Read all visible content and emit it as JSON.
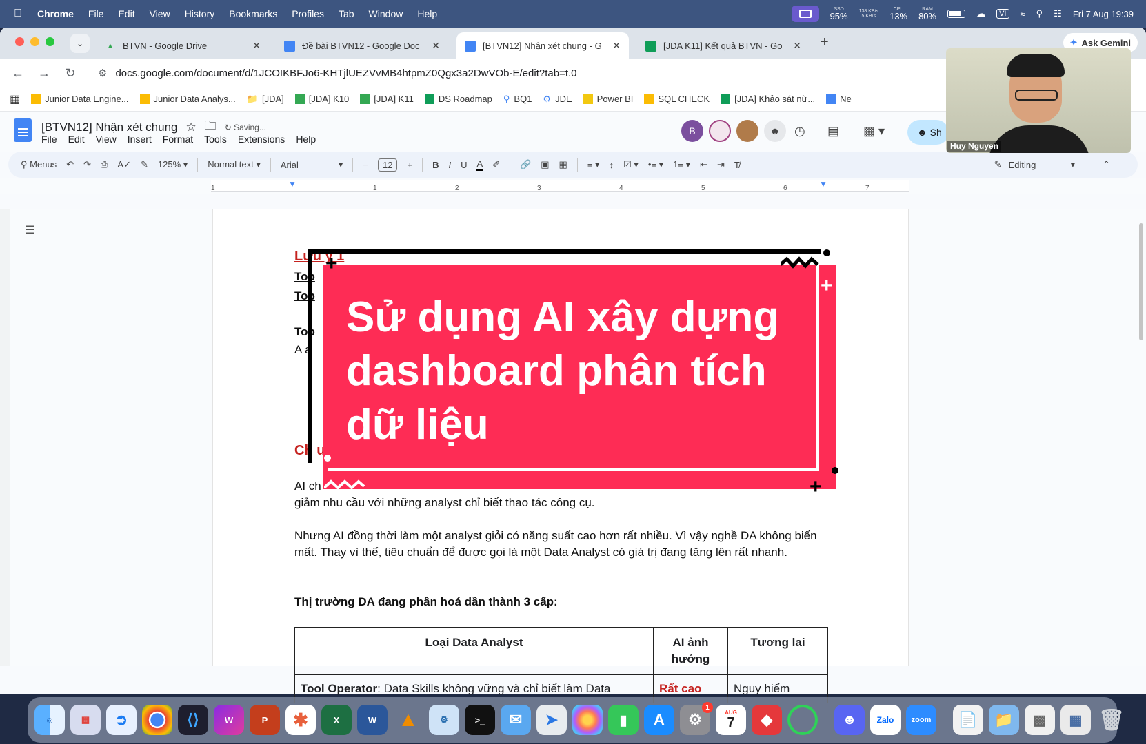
{
  "menubar": {
    "app": "Chrome",
    "items": [
      "File",
      "Edit",
      "View",
      "History",
      "Bookmarks",
      "Profiles",
      "Tab",
      "Window",
      "Help"
    ],
    "ssd": "SSD",
    "ssd_val": "95%",
    "net_up": "138 KB/s",
    "net_down": "5 KB/s",
    "cpu": "CPU",
    "cpu_val": "13%",
    "ram": "RAM",
    "ram_val": "80%",
    "input_lang": "VI",
    "datetime": "Fri 7 Aug  19:39"
  },
  "tabs": [
    {
      "title": "BTVN - Google Drive",
      "icon": "drive-icon"
    },
    {
      "title": "Đề bài BTVN12 - Google Doc",
      "icon": "docs-icon"
    },
    {
      "title": "[BTVN12] Nhận xét chung - G",
      "icon": "docs-icon"
    },
    {
      "title": "[JDA K11] Kết quả BTVN - Go",
      "icon": "sheets-icon"
    }
  ],
  "gemini": "Ask Gemini",
  "url": "docs.google.com/document/d/1JCOIKBFJo6-KHTjlUEZVvMB4htpmZ0Qgx3a2DwVOb-E/edit?tab=t.0",
  "bookmarks": [
    "Junior Data Engine...",
    "Junior Data Analys...",
    "[JDA]",
    "[JDA] K10",
    "[JDA] K11",
    "DS Roadmap",
    "BQ1",
    "JDE",
    "Power BI",
    "SQL CHECK",
    "[JDA] Khảo sát nừ...",
    "Ne"
  ],
  "doc": {
    "title": "[BTVN12] Nhận xét chung",
    "status": "Saving...",
    "menu": [
      "File",
      "Edit",
      "View",
      "Insert",
      "Format",
      "Tools",
      "Extensions",
      "Help"
    ],
    "avatar_b": "B",
    "share": "Sh"
  },
  "toolbar": {
    "menus": "Menus",
    "zoom": "125%",
    "style": "Normal text",
    "font": "Arial",
    "size": "12",
    "mode": "Editing"
  },
  "ruler": [
    "1",
    "1",
    "2",
    "3",
    "4",
    "5",
    "6",
    "7"
  ],
  "body": {
    "h1": "Lưu ý 1",
    "l1": "Top",
    "l2": "Top",
    "l3": "Top",
    "l4": "A  a",
    "h2": "Ch u",
    "p1a": "AI ch",
    "p1b": "giảm nhu cầu với những analyst chỉ biết thao tác công cụ.",
    "p2": "Nhưng AI đồng thời làm một analyst giỏi có năng suất cao hơn rất nhiều. Vì vậy nghề DA không biến mất. Thay vì thế, tiêu chuẩn để được gọi là một Data Analyst có giá trị đang tăng lên rất nhanh.",
    "p3": "Thị trường DA đang phân hoá dần thành 3 cấp:"
  },
  "table": {
    "headers": [
      "Loại Data Analyst",
      "AI ảnh hưởng",
      "Tương lai"
    ],
    "row1": {
      "c1_bold": "Tool Operator",
      "c1_rest": ": Data Skills không vững và chỉ biết làm Data",
      "c2": "Rất cao",
      "c3": "Nguy hiểm"
    }
  },
  "banner": {
    "title": "Sử dụng AI xây dựng dashboard phân tích dữ liệu",
    "color": "#fe2c55"
  },
  "webcam": {
    "name": "Huy Nguyen"
  },
  "dock_labels": {
    "zalo": "Zalo",
    "zoom": "zoom",
    "calendar": "7",
    "calendar_month": "AUG",
    "badge": "1"
  }
}
